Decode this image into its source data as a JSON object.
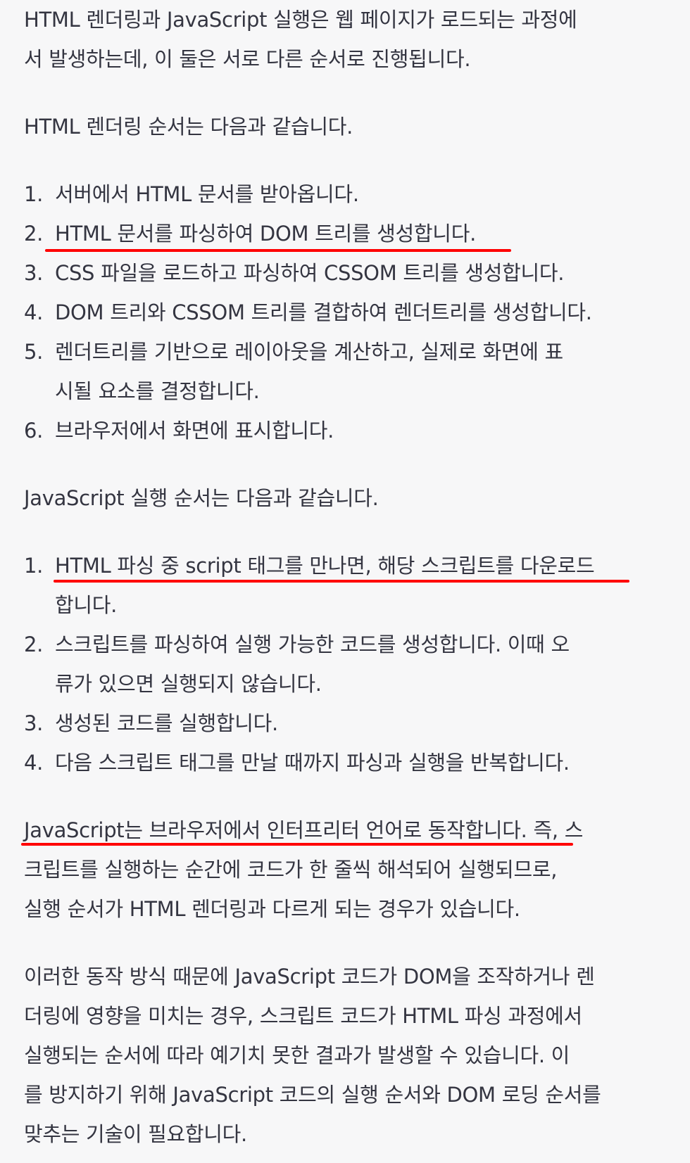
{
  "intro": {
    "line1": "HTML 렌더링과 JavaScript 실행은 웹 페이지가 로드되는 과정에",
    "line2": "서 발생하는데, 이 둘은 서로 다른 순서로 진행됩니다."
  },
  "html_order": {
    "heading": "HTML 렌더링 순서는 다음과 같습니다.",
    "items": [
      {
        "num": "1.",
        "text": "서버에서 HTML 문서를 받아옵니다."
      },
      {
        "num": "2.",
        "text": "HTML 문서를 파싱하여 DOM 트리를 생성합니다."
      },
      {
        "num": "3.",
        "text": "CSS 파일을 로드하고 파싱하여 CSSOM 트리를 생성합니다."
      },
      {
        "num": "4.",
        "text": "DOM 트리와 CSSOM 트리를 결합하여 렌더트리를 생성합니다."
      },
      {
        "num": "5.",
        "line1": "렌더트리를 기반으로 레이아웃을 계산하고, 실제로 화면에 표",
        "line2": "시될 요소를 결정합니다."
      },
      {
        "num": "6.",
        "text": "브라우저에서 화면에 표시합니다."
      }
    ]
  },
  "js_order": {
    "heading": "JavaScript 실행 순서는 다음과 같습니다.",
    "items": [
      {
        "num": "1.",
        "line1": "HTML 파싱 중 script 태그를 만나면, 해당 스크립트를 다운로드",
        "line2": "합니다."
      },
      {
        "num": "2.",
        "line1": "스크립트를 파싱하여 실행 가능한 코드를 생성합니다. 이때 오",
        "line2": "류가 있으면 실행되지 않습니다."
      },
      {
        "num": "3.",
        "text": "생성된 코드를 실행합니다."
      },
      {
        "num": "4.",
        "text": "다음 스크립트 태그를 만날 때까지 파싱과 실행을 반복합니다."
      }
    ]
  },
  "interpreter": {
    "line1_highlight": "JavaScript는 브라우저에서 인터프리터 언어로 동작합니다.",
    "line1_rest": " 즉, 스",
    "line2": "크립트를 실행하는 순간에 코드가 한 줄씩 해석되어 실행되므로,",
    "line3": "실행 순서가 HTML 렌더링과 다르게 되는 경우가 있습니다."
  },
  "conclusion": {
    "line1": "이러한 동작 방식 때문에 JavaScript 코드가 DOM을 조작하거나 렌",
    "line2": "더링에 영향을 미치는 경우, 스크립트 코드가 HTML 파싱 과정에서",
    "line3": "실행되는 순서에 따라 예기치 못한 결과가 발생할 수 있습니다. 이",
    "line4": "를 방지하기 위해 JavaScript 코드의 실행 순서와 DOM 로딩 순서를",
    "line5": "맞추는 기술이 필요합니다."
  },
  "annotation_color": "#ff0000"
}
